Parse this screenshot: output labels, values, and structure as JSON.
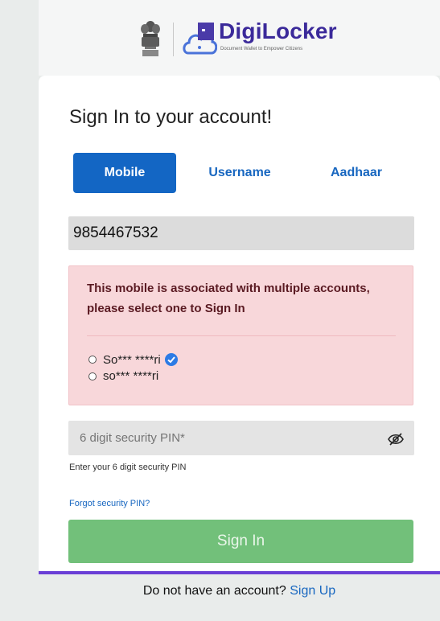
{
  "header": {
    "brand": "DigiLocker",
    "tagline": "Document Wallet to Empower Citizens",
    "emblem_icon": "national-emblem-icon",
    "logo_icon": "digilocker-cloud-logo-icon"
  },
  "card": {
    "title": "Sign In to your account!",
    "tabs": [
      {
        "label": "Mobile",
        "active": true
      },
      {
        "label": "Username",
        "active": false
      },
      {
        "label": "Aadhaar",
        "active": false
      }
    ],
    "mobile_value": "9854467532",
    "alert": {
      "message": "This mobile is associated with multiple accounts, please select one to Sign In",
      "accounts": [
        {
          "label": "So*** ****ri",
          "verified": true
        },
        {
          "label": "so*** ****ri",
          "verified": false
        }
      ]
    },
    "pin": {
      "placeholder": "6 digit security PIN*",
      "help": "Enter your 6 digit security PIN",
      "toggle_icon": "eye-off-icon"
    },
    "forgot_link": "Forgot security PIN?",
    "signin_label": "Sign In"
  },
  "footer": {
    "text": "Do not have an account?",
    "link": "Sign Up"
  },
  "colors": {
    "primary": "#1366c4",
    "brand": "#3b2a9a",
    "alert_bg": "#f8d7da",
    "signin_bg": "#72c07a",
    "accent_border": "#6a3fd6"
  }
}
